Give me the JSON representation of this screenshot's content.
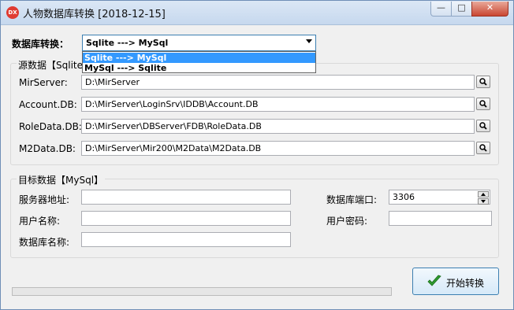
{
  "window": {
    "title": "人物数据库转换 [2018-12-15]",
    "icon_text": "DX",
    "controls": {
      "minimize": "—",
      "maximize": "□",
      "close": "✕"
    }
  },
  "conversion": {
    "label": "数据库转换：",
    "selected": "Sqlite ---> MySql",
    "options": [
      "Sqlite ---> MySql",
      "MySql ---> Sqlite"
    ]
  },
  "source_group": {
    "title": "源数据【Sqlite】",
    "rows": [
      {
        "label": "MirServer:",
        "value": "D:\\MirServer"
      },
      {
        "label": "Account.DB:",
        "value": "D:\\MirServer\\LoginSrv\\IDDB\\Account.DB"
      },
      {
        "label": "RoleData.DB:",
        "value": "D:\\MirServer\\DBServer\\FDB\\RoleData.DB"
      },
      {
        "label": "M2Data.DB:",
        "value": "D:\\MirServer\\Mir200\\M2Data\\M2Data.DB"
      }
    ]
  },
  "target_group": {
    "title": "目标数据【MySql】",
    "server_label": "服务器地址:",
    "server_value": "",
    "user_label": "用户名称:",
    "user_value": "",
    "dbname_label": "数据库名称:",
    "dbname_value": "",
    "port_label": "数据库端口:",
    "port_value": "3306",
    "password_label": "用户密码:",
    "password_value": ""
  },
  "progress": {
    "value": 0
  },
  "start_button": {
    "label": "开始转换"
  },
  "colors": {
    "accent": "#3399ff",
    "check": "#2e9b2e",
    "close": "#c94632"
  },
  "icons": {
    "search": "search-icon",
    "check": "check-icon"
  }
}
